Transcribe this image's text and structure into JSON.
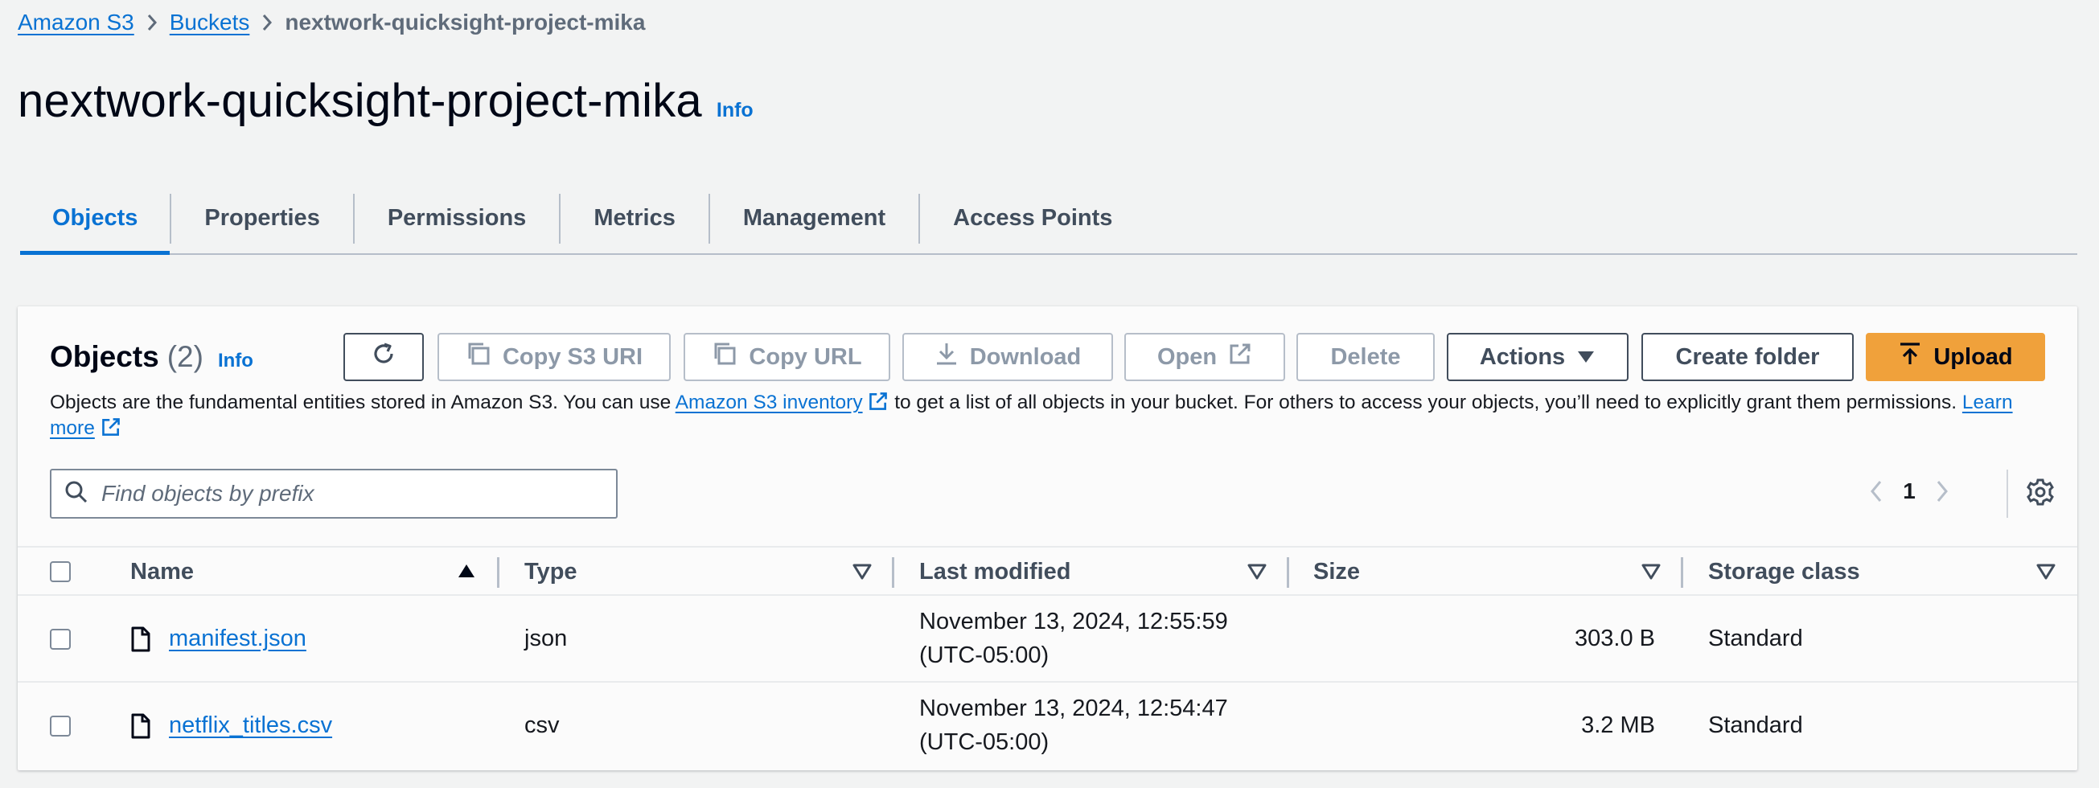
{
  "breadcrumb": {
    "items": [
      "Amazon S3",
      "Buckets"
    ],
    "current": "nextwork-quicksight-project-mika"
  },
  "header": {
    "title": "nextwork-quicksight-project-mika",
    "info": "Info"
  },
  "tabs": [
    "Objects",
    "Properties",
    "Permissions",
    "Metrics",
    "Management",
    "Access Points"
  ],
  "objects_panel": {
    "title": "Objects",
    "count": "(2)",
    "info": "Info",
    "buttons": {
      "copy_s3_uri": "Copy S3 URI",
      "copy_url": "Copy URL",
      "download": "Download",
      "open": "Open",
      "delete": "Delete",
      "actions": "Actions",
      "create_folder": "Create folder",
      "upload": "Upload"
    },
    "description": {
      "part1": "Objects are the fundamental entities stored in Amazon S3. You can use ",
      "inventory_link": "Amazon S3 inventory",
      "part2": " to get a list of all objects in your bucket. For others to access your objects, you’ll need to explicitly grant them permissions. ",
      "learn_more": "Learn more"
    },
    "search_placeholder": "Find objects by prefix",
    "page": "1"
  },
  "table": {
    "columns": [
      "Name",
      "Type",
      "Last modified",
      "Size",
      "Storage class"
    ],
    "rows": [
      {
        "name": "manifest.json",
        "type": "json",
        "modified_date": "November 13, 2024, 12:55:59",
        "modified_tz": "(UTC-05:00)",
        "size": "303.0 B",
        "storage_class": "Standard"
      },
      {
        "name": "netflix_titles.csv",
        "type": "csv",
        "modified_date": "November 13, 2024, 12:54:47",
        "modified_tz": "(UTC-05:00)",
        "size": "3.2 MB",
        "storage_class": "Standard"
      }
    ]
  },
  "colors": {
    "link": "#0972d3",
    "primary_button": "#f0a13b",
    "background": "#f2f3f3",
    "disabled_text": "#8d99a8"
  },
  "icons": [
    "chevron-right-icon",
    "refresh-icon",
    "copy-icon",
    "download-icon",
    "external-link-icon",
    "caret-down-icon",
    "upload-icon",
    "search-icon",
    "angle-left-icon",
    "angle-right-icon",
    "settings-icon",
    "sort-ascending-icon",
    "sort-icon",
    "file-icon"
  ]
}
